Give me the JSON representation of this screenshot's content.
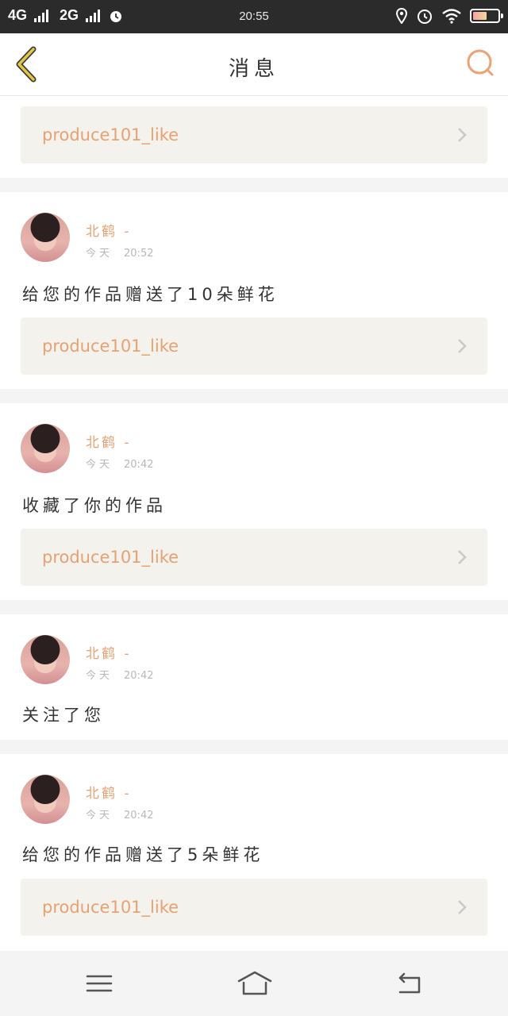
{
  "status_bar": {
    "network1": "4G",
    "network2": "2G",
    "time": "20:55",
    "battery_level": 0.55
  },
  "nav": {
    "title": "消息",
    "back_icon": "chevron-left-icon",
    "search_icon": "search-icon"
  },
  "messages": [
    {
      "link": "produce101_like"
    },
    {
      "user": "北鹤 -",
      "day": "今天",
      "time": "20:52",
      "text": "给您的作品赠送了10朵鲜花",
      "link": "produce101_like"
    },
    {
      "user": "北鹤 -",
      "day": "今天",
      "time": "20:42",
      "text": "收藏了你的作品",
      "link": "produce101_like"
    },
    {
      "user": "北鹤 -",
      "day": "今天",
      "time": "20:42",
      "text": "关注了您"
    },
    {
      "user": "北鹤 -",
      "day": "今天",
      "time": "20:42",
      "text": "给您的作品赠送了5朵鲜花",
      "link": "produce101_like"
    }
  ],
  "bottom_nav": {
    "menu_icon": "menu-icon",
    "home_icon": "home-icon",
    "back_icon": "back-icon"
  },
  "colors": {
    "accent": "#e8a173",
    "back_arrow": "#d9b83a"
  }
}
